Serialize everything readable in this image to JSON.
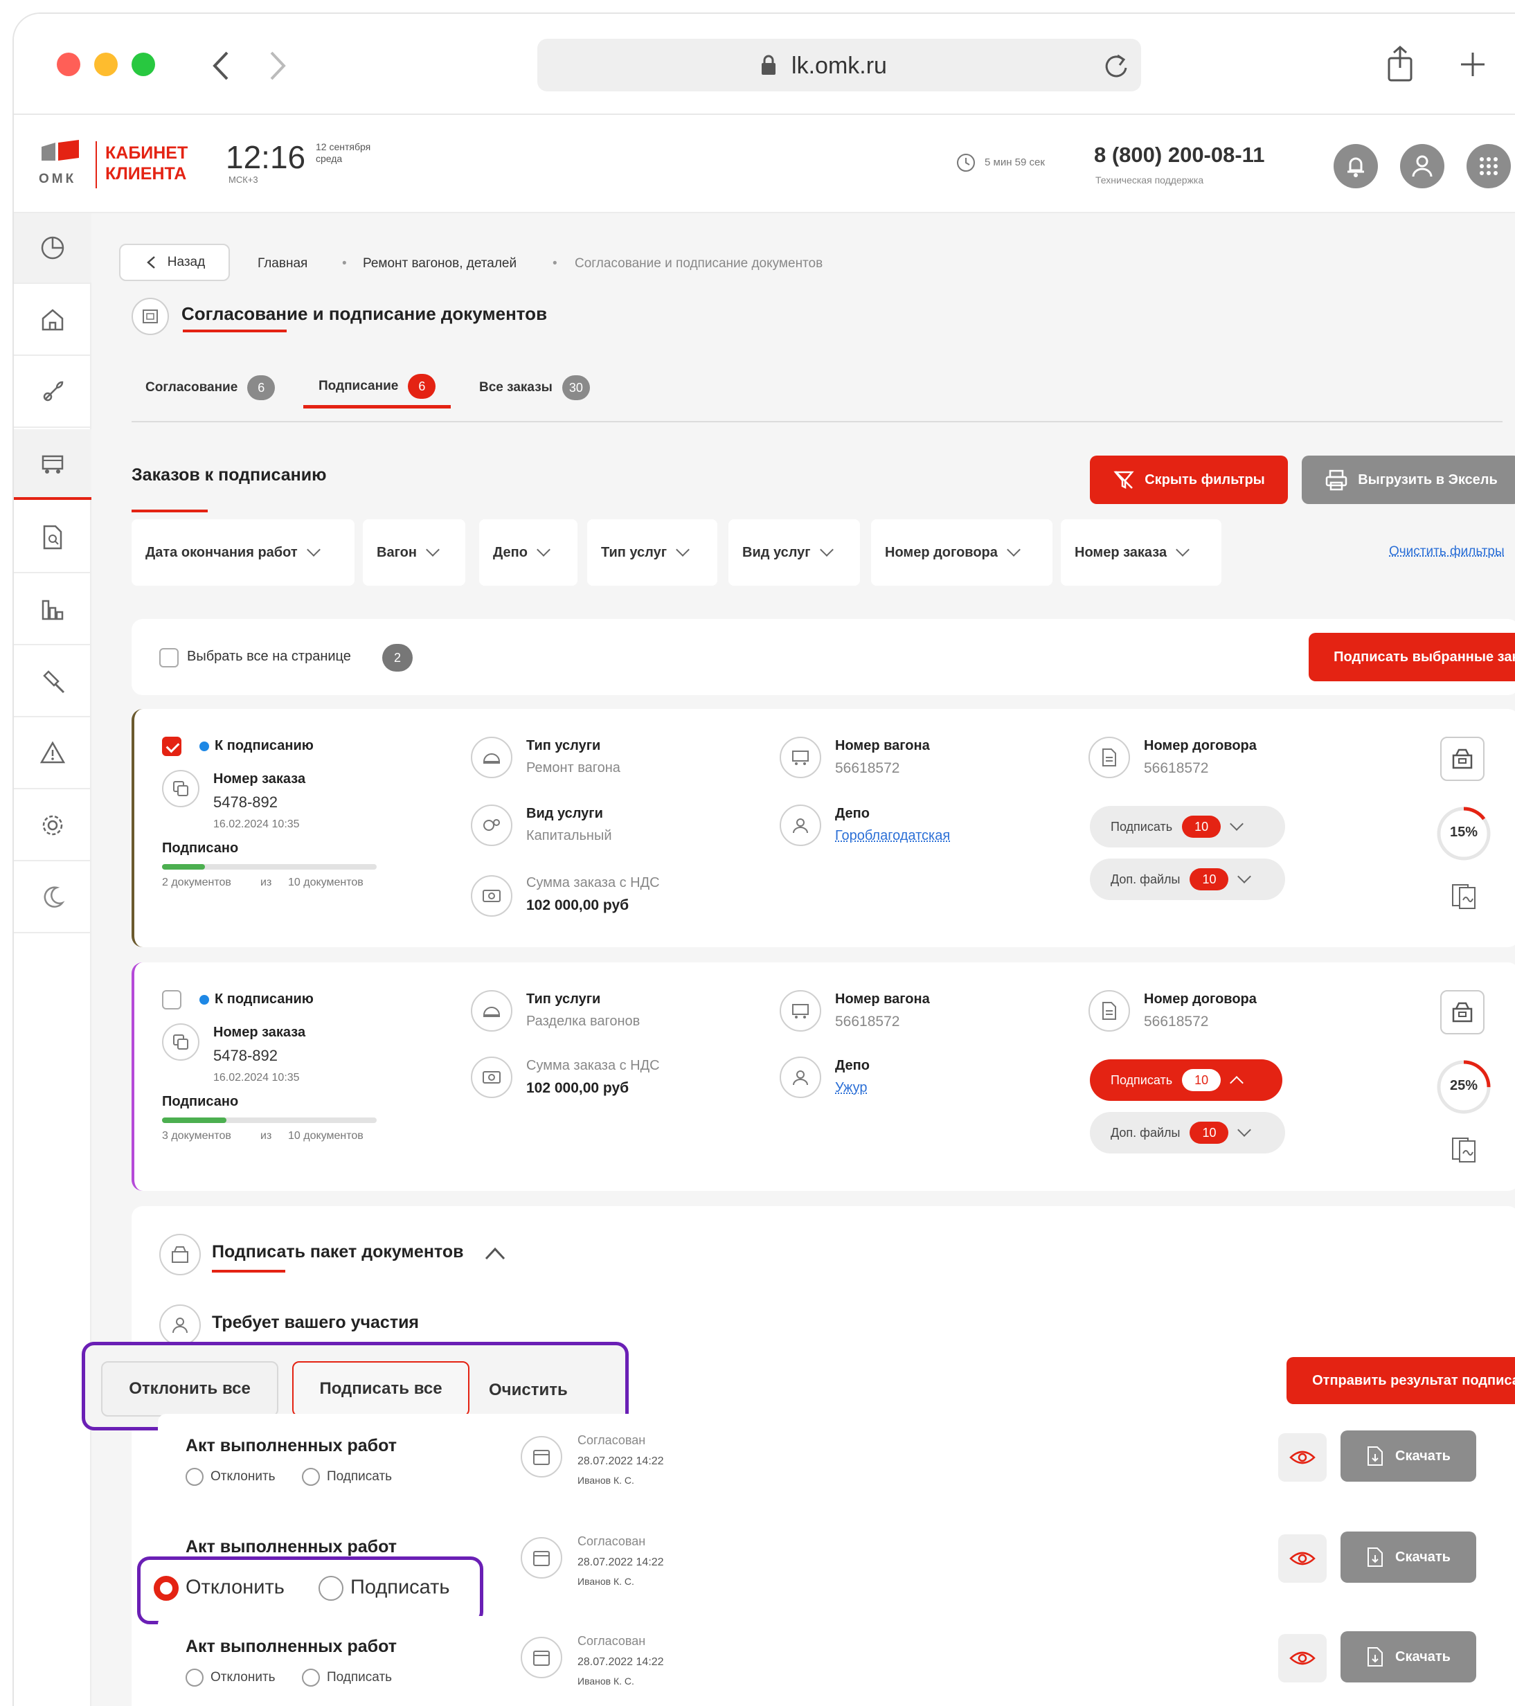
{
  "browser": {
    "url": "lk.omk.ru"
  },
  "header": {
    "logo_text": "ОМК",
    "cabinet_line1": "КАБИНЕТ",
    "cabinet_line2": "КЛИЕНТА",
    "time": "12:16",
    "date_line1": "12 сентября",
    "date_line2": "среда",
    "timezone": "МСК+3",
    "session_timer": "5 мин 59 сек",
    "phone": "8 (800) 200-08-11",
    "phone_caption": "Техническая поддержка"
  },
  "breadcrumbs": {
    "back": "Назад",
    "items": [
      "Главная",
      "Ремонт вагонов, деталей",
      "Согласование и подписание документов"
    ],
    "separator": "•"
  },
  "page_title": "Согласование и подписание документов",
  "tabs": [
    {
      "label": "Согласование",
      "count": "6"
    },
    {
      "label": "Подписание",
      "count": "6"
    },
    {
      "label": "Все заказы",
      "count": "30"
    }
  ],
  "section": {
    "title": "Заказов к подписанию",
    "hide_filters": "Скрыть фильтры",
    "export": "Выгрузить в Эксель"
  },
  "filters": {
    "items": [
      "Дата окончания работ",
      "Вагон",
      "Депо",
      "Тип услуг",
      "Вид услуг",
      "Номер договора",
      "Номер заказа"
    ],
    "clear": "Очистить фильтры"
  },
  "select_bar": {
    "select_all": "Выбрать все на странице",
    "count": "2",
    "sign_selected": "Подписать выбранные заказы"
  },
  "orders": [
    {
      "status": "К подписанию",
      "order_label": "Номер заказа",
      "order_no": "5478-892",
      "order_date": "16.02.2024 10:35",
      "signed_label": "Подписано",
      "progress": 0.2,
      "docs_done": "2 документов",
      "docs_of": "из",
      "docs_total": "10 документов",
      "service_type_label": "Тип услуги",
      "service_type": "Ремонт вагона",
      "service_kind_label": "Вид услуги",
      "service_kind": "Капитальный",
      "sum_label": "Сумма заказа с НДС",
      "sum": "102 000,00 руб",
      "wagon_label": "Номер вагона",
      "wagon": "56618572",
      "depot_label": "Депо",
      "depot": "Гороблагодатская",
      "contract_label": "Номер договора",
      "contract": "56618572",
      "sign_pill": "Подписать",
      "sign_count": "10",
      "files_pill": "Доп. файлы",
      "files_count": "10",
      "percent": "15%",
      "percent_value": 15
    },
    {
      "status": "К подписанию",
      "order_label": "Номер заказа",
      "order_no": "5478-892",
      "order_date": "16.02.2024 10:35",
      "signed_label": "Подписано",
      "progress": 0.3,
      "docs_done": "3 документов",
      "docs_of": "из",
      "docs_total": "10 документов",
      "service_type_label": "Тип услуги",
      "service_type": "Разделка вагонов",
      "sum_label": "Сумма заказа с НДС",
      "sum": "102 000,00 руб",
      "wagon_label": "Номер вагона",
      "wagon": "56618572",
      "depot_label": "Депо",
      "depot": "Ужур",
      "contract_label": "Номер договора",
      "contract": "56618572",
      "sign_pill": "Подписать",
      "sign_count": "10",
      "files_pill": "Доп. файлы",
      "files_count": "10",
      "percent": "25%",
      "percent_value": 25
    }
  ],
  "package": {
    "title": "Подписать пакет документов",
    "participation": "Требует вашего участия",
    "reject_all": "Отклонить все",
    "sign_all": "Подписать все",
    "clear": "Очистить",
    "send_result": "Отправить результат подписания"
  },
  "documents": [
    {
      "name": "Акт выполненных работ",
      "reject": "Отклонить",
      "sign": "Подписать",
      "status": "Согласован",
      "date": "28.07.2022 14:22",
      "person": "Иванов К. С.",
      "download": "Скачать"
    },
    {
      "name": "Акт выполненных работ",
      "reject": "Отклонить",
      "sign": "Подписать",
      "status": "Согласован",
      "date": "28.07.2022 14:22",
      "person": "Иванов К. С.",
      "download": "Скачать"
    },
    {
      "name": "Акт выполненных работ",
      "reject": "Отклонить",
      "sign": "Подписать",
      "status": "Согласован",
      "date": "28.07.2022 14:22",
      "person": "Иванов К. С.",
      "download": "Скачать"
    }
  ],
  "colors": {
    "accent": "#e42313",
    "highlight": "#6a1fb5",
    "progress": "#4caf50",
    "link": "#2b6fd6"
  }
}
